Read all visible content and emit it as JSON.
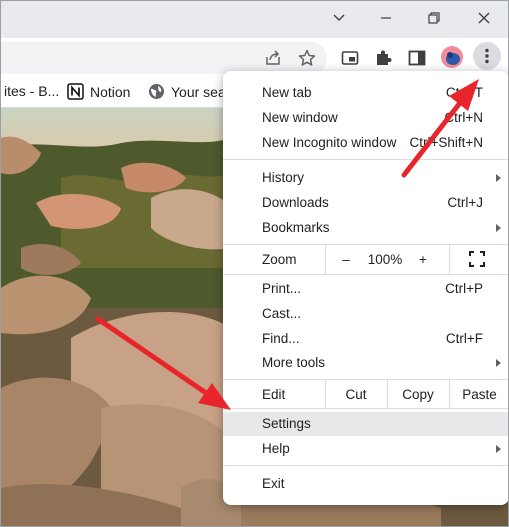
{
  "window": {
    "minimize_icon": "chevron-down-icon",
    "restore_icon": "restore-icon",
    "close_icon": "close-icon"
  },
  "toolbar": {
    "share_icon": "share-icon",
    "bookmark_icon": "star-icon",
    "pip_icon": "picture-in-picture-icon",
    "extensions_icon": "puzzle-icon",
    "sidepanel_icon": "side-panel-icon",
    "profile_icon": "avatar",
    "menu_icon": "kebab-menu-icon"
  },
  "bookmarks": {
    "items": [
      {
        "label": "ites - B...",
        "icon": "page-icon"
      },
      {
        "label": "Notion",
        "icon": "notion-icon"
      },
      {
        "label": "Your sea",
        "icon": "globe-icon"
      }
    ]
  },
  "menu": {
    "new_tab": {
      "label": "New tab",
      "shortcut": "Ctrl+T"
    },
    "new_window": {
      "label": "New window",
      "shortcut": "Ctrl+N"
    },
    "new_incognito": {
      "label": "New Incognito window",
      "shortcut": "Ctrl+Shift+N"
    },
    "history": {
      "label": "History"
    },
    "downloads": {
      "label": "Downloads",
      "shortcut": "Ctrl+J"
    },
    "bookmarks": {
      "label": "Bookmarks"
    },
    "zoom": {
      "label": "Zoom",
      "minus": "–",
      "value": "100%",
      "plus": "+"
    },
    "print": {
      "label": "Print...",
      "shortcut": "Ctrl+P"
    },
    "cast": {
      "label": "Cast..."
    },
    "find": {
      "label": "Find...",
      "shortcut": "Ctrl+F"
    },
    "more_tools": {
      "label": "More tools"
    },
    "edit": {
      "label": "Edit",
      "cut": "Cut",
      "copy": "Copy",
      "paste": "Paste"
    },
    "settings": {
      "label": "Settings"
    },
    "help": {
      "label": "Help"
    },
    "exit": {
      "label": "Exit"
    }
  },
  "colors": {
    "arrow": "#e8252b",
    "titlebar": "#e8eaed",
    "highlight": "#e8e8e8"
  }
}
